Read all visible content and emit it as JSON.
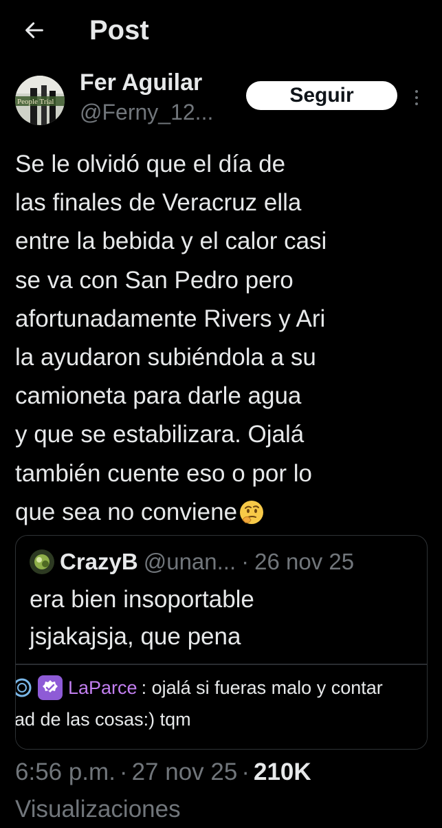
{
  "header": {
    "title": "Post",
    "back_icon": "arrow-left-icon"
  },
  "author": {
    "name": "Fer Aguilar",
    "handle": "@Ferny_12...",
    "avatar_text": "People Trial",
    "follow_label": "Seguir",
    "more_icon": "more-vertical-icon"
  },
  "tweet": {
    "lines": [
      "Se le olvidó que el día de",
      "las finales de Veracruz ella",
      "entre la bebida y el calor casi",
      "se va con San Pedro pero",
      "afortunadamente Rivers y Ari",
      "la ayudaron subiéndola a su",
      "camioneta para darle agua",
      "y que se estabilizara. Ojalá",
      "también cuente eso o por lo",
      "que sea no conviene"
    ],
    "emoji": "thinking-face-emoji"
  },
  "quote": {
    "name": "CrazyB",
    "handle": "@unan...",
    "separator": "·",
    "date": "26 nov 25",
    "lines": [
      "era bien insoportable",
      "jsjakajsja, que pena"
    ],
    "image": {
      "username": "LaParce",
      "message": ": ojalá si fueras malo y contar",
      "line2": "ad de las cosas:) tqm"
    }
  },
  "meta": {
    "time": "6:56 p.m.",
    "separator": "·",
    "date": "27 nov 25",
    "views_count": "210K",
    "views_label": "Visualizaciones"
  },
  "colors": {
    "background": "#000000",
    "text": "#e7e9ea",
    "muted": "#71767b",
    "border": "#2f3336",
    "chat_username": "#c27ff0",
    "badge": "#8e5bd6"
  }
}
